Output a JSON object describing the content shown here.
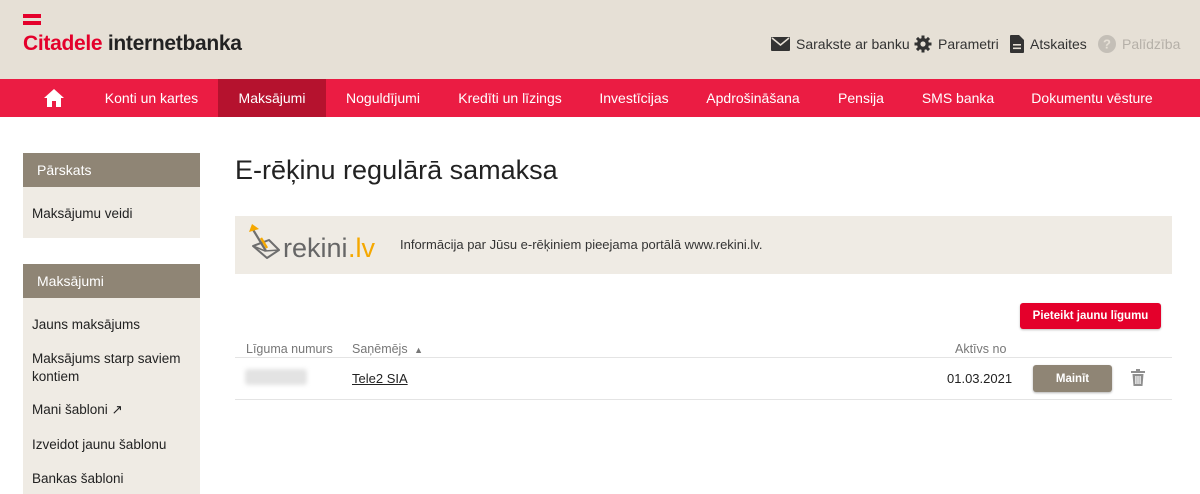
{
  "brand": {
    "name_red": "Citadele",
    "name_rest": " internetbanka",
    "color": "#e4002b"
  },
  "utility": {
    "messages": "Sarakste ar banku",
    "settings": "Parametri",
    "reports": "Atskaites",
    "help": "Palīdzība"
  },
  "nav": {
    "items": [
      {
        "label": "Konti un kartes"
      },
      {
        "label": "Maksājumi",
        "active": true
      },
      {
        "label": "Noguldījumi"
      },
      {
        "label": "Kredīti un līzings"
      },
      {
        "label": "Investīcijas"
      },
      {
        "label": "Apdrošināšana"
      },
      {
        "label": "Pensija"
      },
      {
        "label": "SMS banka"
      },
      {
        "label": "Dokumentu vēsture"
      }
    ],
    "color": "#eb1c43",
    "active_color": "#b5122e"
  },
  "sidebar": {
    "overview": {
      "title": "Pārskats",
      "items": [
        "Maksājumu veidi"
      ]
    },
    "payments": {
      "title": "Maksājumi",
      "items": [
        "Jauns maksājums",
        "Maksājums starp saviem kontiem",
        "Mani šabloni ↗",
        "Izveidot jaunu šablonu",
        "Bankas šabloni"
      ]
    }
  },
  "main": {
    "title": "E-rēķinu regulārā samaksa",
    "banner": {
      "logo_text_a": "rekini",
      "logo_text_b": ".lv",
      "text": "Informācija par Jūsu e-rēķiniem pieejama portālā www.rekini.lv."
    },
    "new_contract_button": "Pieteikt jaunu līgumu",
    "table": {
      "headers": {
        "contract_no": "Līguma numurs",
        "recipient": "Saņēmējs",
        "active_from": "Aktīvs no"
      },
      "sort_indicator": "▲",
      "rows": [
        {
          "contract_no": "",
          "recipient": "Tele2 SIA",
          "active_from": "01.03.2021",
          "action": "Mainīt"
        }
      ]
    }
  }
}
